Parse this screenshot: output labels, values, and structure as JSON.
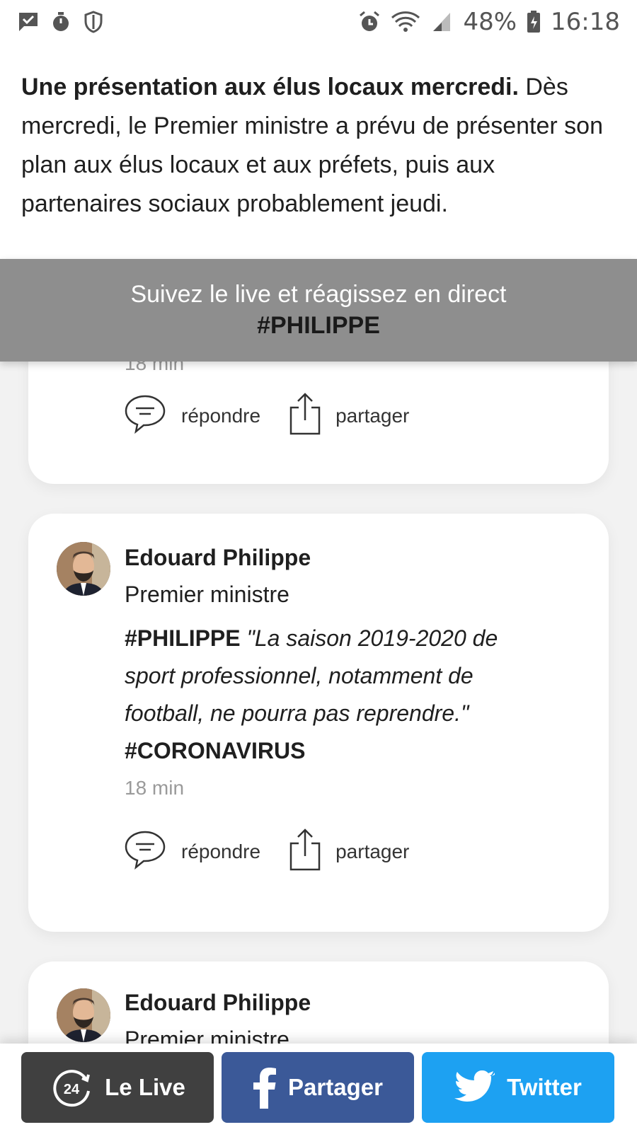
{
  "status_bar": {
    "battery": "48%",
    "time": "16:18",
    "icons_left": [
      "message-icon",
      "stopwatch-icon",
      "shield-icon"
    ],
    "icons_right": [
      "alarm-icon",
      "wifi-icon",
      "signal-icon",
      "battery-icon"
    ]
  },
  "article": {
    "bold_lead": "Une présentation aux élus locaux mercredi.",
    "text": " Dès mercredi, le Premier ministre a prévu de présenter son plan aux élus locaux et aux préfets, puis aux partenaires sociaux probablement jeudi."
  },
  "live_banner": {
    "line1": "Suivez le live et réagissez en direct",
    "line2": "#PHILIPPE"
  },
  "card1": {
    "time": "18 min",
    "reply_label": "répondre",
    "share_label": "partager"
  },
  "card2": {
    "author": "Edouard Philippe",
    "role": "Premier ministre",
    "tag1": "#PHILIPPE",
    "quote": "\"La saison 2019-2020 de sport professionnel, notamment de football, ne pourra pas reprendre.\"",
    "tag2": "#CORONAVIRUS",
    "time": "18 min",
    "reply_label": "répondre",
    "share_label": "partager"
  },
  "card3": {
    "author": "Edouard Philippe",
    "role": "Premier ministre"
  },
  "bottom_bar": {
    "live_label": "Le Live",
    "live_badge": "24",
    "facebook_label": "Partager",
    "twitter_label": "Twitter",
    "colors": {
      "live": "#404040",
      "facebook": "#3b5998",
      "twitter": "#1da1f2"
    }
  }
}
